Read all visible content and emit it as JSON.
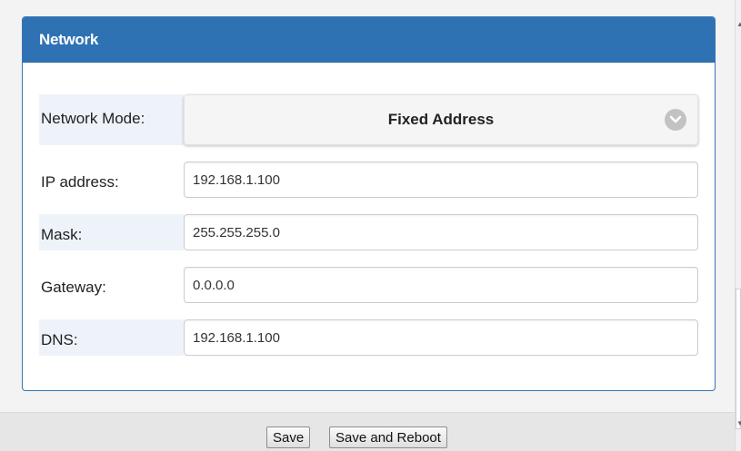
{
  "panel": {
    "title": "Network"
  },
  "form": {
    "network_mode": {
      "label": "Network Mode:",
      "value": "Fixed Address"
    },
    "ip_address": {
      "label": "IP address:",
      "value": "192.168.1.100"
    },
    "mask": {
      "label": "Mask:",
      "value": "255.255.255.0"
    },
    "gateway": {
      "label": "Gateway:",
      "value": "0.0.0.0"
    },
    "dns": {
      "label": "DNS:",
      "value": "192.168.1.100"
    }
  },
  "footer": {
    "save_label": "Save",
    "save_reboot_label": "Save and Reboot"
  },
  "colors": {
    "header": "#2f72b4",
    "label_shade": "#eef3fa"
  }
}
